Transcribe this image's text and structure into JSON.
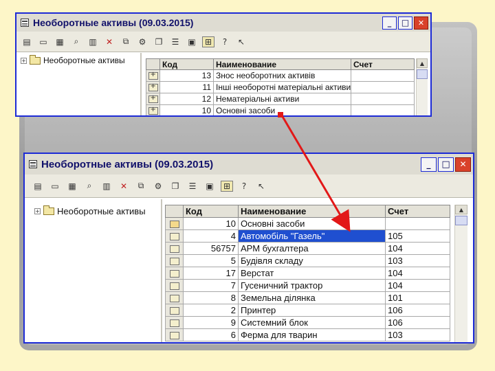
{
  "top_window": {
    "title": "Необоротные активы (09.03.2015)",
    "tree_root": "Необоротные активы",
    "columns": [
      "Код",
      "Наименование",
      "Счет"
    ],
    "rows": [
      {
        "code": "13",
        "name": "Знос необоротних активів",
        "account": ""
      },
      {
        "code": "11",
        "name": "Інші необоротні матеріальні активи",
        "account": ""
      },
      {
        "code": "12",
        "name": "Нематеріальні активи",
        "account": ""
      },
      {
        "code": "10",
        "name": "Основні засоби",
        "account": ""
      }
    ]
  },
  "bottom_window": {
    "title": "Необоротные активы (09.03.2015)",
    "tree_root": "Необоротные активы",
    "columns": [
      "Код",
      "Наименование",
      "Счет"
    ],
    "rows": [
      {
        "code": "10",
        "name": "Основні засоби",
        "account": "",
        "type": "group"
      },
      {
        "code": "4",
        "name": "Автомобіль \"Газель\"",
        "account": "105",
        "type": "item",
        "selected": true
      },
      {
        "code": "56757",
        "name": "АРМ бухгалтера",
        "account": "104",
        "type": "item"
      },
      {
        "code": "5",
        "name": "Будівля складу",
        "account": "103",
        "type": "item"
      },
      {
        "code": "17",
        "name": "Верстат",
        "account": "104",
        "type": "item"
      },
      {
        "code": "7",
        "name": "Гусеничний трактор",
        "account": "104",
        "type": "item"
      },
      {
        "code": "8",
        "name": "Земельна ділянка",
        "account": "101",
        "type": "item"
      },
      {
        "code": "2",
        "name": "Принтер",
        "account": "106",
        "type": "item"
      },
      {
        "code": "9",
        "name": "Системний блок",
        "account": "106",
        "type": "item"
      },
      {
        "code": "6",
        "name": "Ферма для тварин",
        "account": "103",
        "type": "item"
      }
    ]
  },
  "window_buttons": {
    "minimize": "_",
    "maximize": "□",
    "close": "✕"
  },
  "icons": [
    "add-row-icon",
    "add-folder-icon",
    "copy-icon",
    "find-icon",
    "edit-icon",
    "delete-icon",
    "move-icon",
    "filter-icon",
    "copy-doc-icon",
    "list-icon",
    "paste-icon",
    "tree-toggle-icon",
    "help-icon",
    "context-help-icon"
  ],
  "colors": {
    "frame": "#1c2ad6",
    "selection": "#1f4fd0",
    "arrow": "#e21818",
    "background": "#fdf6c8"
  }
}
